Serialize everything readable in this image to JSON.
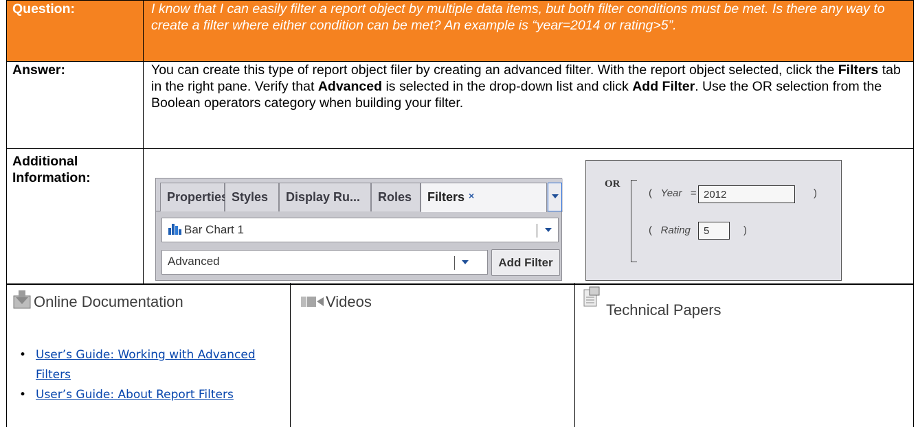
{
  "question": {
    "label": "Question:",
    "text": "I know that I can easily filter a report object by multiple data items, but both filter conditions must be met. Is there any way to create a filter where either condition can be met? An example is “year=2014 or rating>5”."
  },
  "answer": {
    "label": "Answer:",
    "seg1": "You can create this type of report object filer by creating an advanced filter. With the report object selected, click the ",
    "bold1": "Filters",
    "seg2": " tab in the right pane. Verify that ",
    "bold2": "Advanced",
    "seg3": " is selected in the drop-down list and click ",
    "bold3": "Add Filter",
    "seg4": ". Use the OR selection from the Boolean operators category when building your filter."
  },
  "additional": {
    "label_line1": "Additional",
    "label_line2": "Information:"
  },
  "filters_panel": {
    "tabs": [
      "Properties",
      "Styles",
      "Display Ru...",
      "Roles",
      "Filters"
    ],
    "tab_close": "×",
    "object_select": "Bar Chart 1",
    "mode_select": "Advanced",
    "add_filter_button": "Add Filter"
  },
  "or_expression": {
    "operator": "OR",
    "cond1_field": "Year",
    "cond1_op": "=",
    "cond1_value": "2012",
    "cond2_field": "Rating",
    "cond2_op": ">",
    "cond2_value": "5",
    "open_paren": "(",
    "close_paren": ")"
  },
  "resources": {
    "online_docs": {
      "heading": "Online Documentation",
      "links": [
        "User’s Guide: Working with Advanced Filters",
        "User’s Guide: About Report Filters"
      ]
    },
    "videos": {
      "heading": "Videos"
    },
    "papers": {
      "heading": "Technical Papers"
    }
  },
  "colors": {
    "question_band": "#f58220",
    "link": "#0645ad",
    "panel_gray": "#c9c9cf"
  },
  "icons": [
    "bar-chart-icon",
    "dropdown-arrow-icon",
    "close-icon",
    "download-icon",
    "video-camera-icon",
    "document-icon"
  ]
}
